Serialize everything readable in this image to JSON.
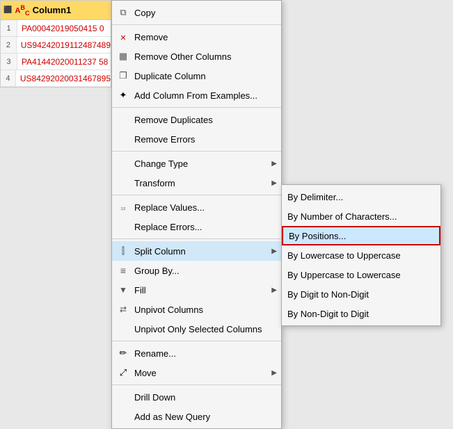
{
  "table": {
    "header": {
      "label": "Column1",
      "type_icon": "ABC",
      "sort_icon": "↕"
    },
    "rows": [
      {
        "num": "1",
        "value": "PA00042019050415 0"
      },
      {
        "num": "2",
        "value": "US94242019112487489"
      },
      {
        "num": "3",
        "value": "PA41442020011237 58"
      },
      {
        "num": "4",
        "value": "US84292020031467895"
      }
    ]
  },
  "context_menu": {
    "items": [
      {
        "id": "copy",
        "label": "Copy",
        "icon": "copy",
        "separator_after": false
      },
      {
        "id": "remove",
        "label": "Remove",
        "icon": "remove",
        "separator_after": false
      },
      {
        "id": "remove-other-columns",
        "label": "Remove Other Columns",
        "icon": "table",
        "separator_after": false
      },
      {
        "id": "duplicate-column",
        "label": "Duplicate Column",
        "icon": "dup",
        "separator_after": false
      },
      {
        "id": "add-column-from-examples",
        "label": "Add Column From Examples...",
        "icon": "add-col",
        "separator_after": true
      },
      {
        "id": "remove-duplicates",
        "label": "Remove Duplicates",
        "icon": "",
        "separator_after": false
      },
      {
        "id": "remove-errors",
        "label": "Remove Errors",
        "icon": "",
        "separator_after": true
      },
      {
        "id": "change-type",
        "label": "Change Type",
        "icon": "",
        "has_arrow": true,
        "separator_after": false
      },
      {
        "id": "transform",
        "label": "Transform",
        "icon": "",
        "has_arrow": true,
        "separator_after": true
      },
      {
        "id": "replace-values",
        "label": "Replace Values...",
        "icon": "12",
        "separator_after": false
      },
      {
        "id": "replace-errors",
        "label": "Replace Errors...",
        "icon": "",
        "separator_after": true
      },
      {
        "id": "split-column",
        "label": "Split Column",
        "icon": "split",
        "has_arrow": true,
        "separator_after": false,
        "active": true
      },
      {
        "id": "group-by",
        "label": "Group By...",
        "icon": "group",
        "separator_after": false
      },
      {
        "id": "fill",
        "label": "Fill",
        "icon": "fill",
        "has_arrow": true,
        "separator_after": false
      },
      {
        "id": "unpivot-columns",
        "label": "Unpivot Columns",
        "icon": "unpivot",
        "separator_after": false
      },
      {
        "id": "unpivot-only-selected",
        "label": "Unpivot Only Selected Columns",
        "icon": "",
        "separator_after": true
      },
      {
        "id": "rename",
        "label": "Rename...",
        "icon": "rename",
        "separator_after": false
      },
      {
        "id": "move",
        "label": "Move",
        "icon": "move",
        "has_arrow": true,
        "separator_after": true
      },
      {
        "id": "drill-down",
        "label": "Drill Down",
        "icon": "",
        "separator_after": false
      },
      {
        "id": "add-new-query",
        "label": "Add as New Query",
        "icon": "",
        "separator_after": false
      }
    ]
  },
  "submenu": {
    "items": [
      {
        "id": "by-delimiter",
        "label": "By Delimiter..."
      },
      {
        "id": "by-number-of-characters",
        "label": "By Number of Characters..."
      },
      {
        "id": "by-positions",
        "label": "By Positions...",
        "highlighted": true
      },
      {
        "id": "by-lowercase-to-uppercase",
        "label": "By Lowercase to Uppercase"
      },
      {
        "id": "by-uppercase-to-lowercase",
        "label": "By Uppercase to Lowercase"
      },
      {
        "id": "by-digit-to-non-digit",
        "label": "By Digit to Non-Digit"
      },
      {
        "id": "by-non-digit-to-digit",
        "label": "By Non-Digit to Digit"
      }
    ]
  }
}
